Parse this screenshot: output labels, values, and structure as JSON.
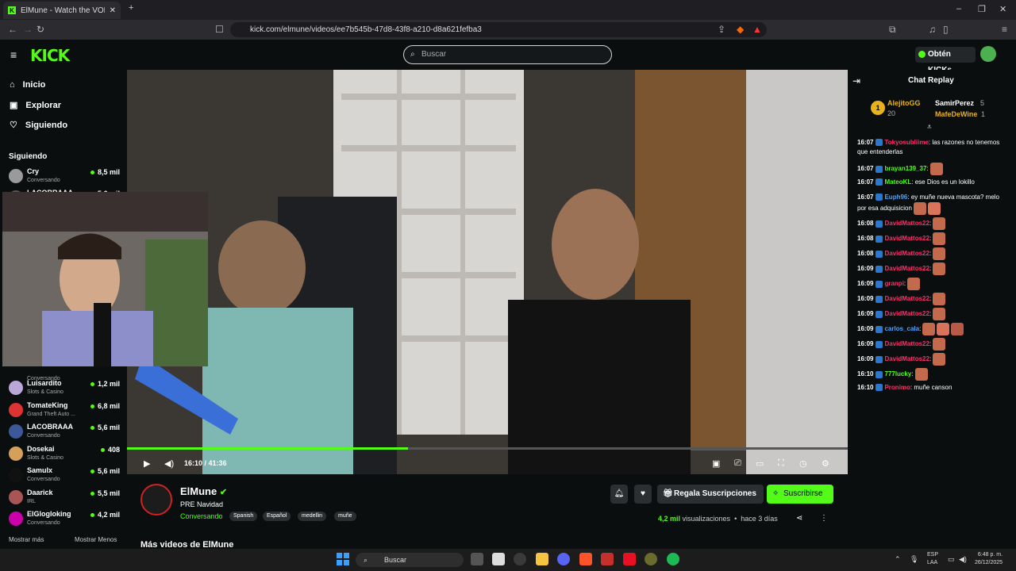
{
  "browser": {
    "tab_title": "ElMune - Watch the VOD on Kick",
    "new_tab": "+",
    "url": "kick.com/elmune/videos/ee7b545b-47d8-43f8-a210-d8a621fefba3",
    "window_controls": [
      "–",
      "❐",
      "✕"
    ]
  },
  "header": {
    "logo": "KICK",
    "search_placeholder": "Buscar",
    "kicks_button": "Obtén KICKs"
  },
  "sidebar": {
    "nav": [
      {
        "label": "Inicio",
        "icon": "home-icon"
      },
      {
        "label": "Explorar",
        "icon": "explore-icon"
      },
      {
        "label": "Siguiendo",
        "icon": "heart-icon"
      }
    ],
    "following_title": "Siguiendo",
    "channels": [
      {
        "name": "Cry",
        "category": "Conversando",
        "viewers": "8,5 mil",
        "color": "#9a9a9a"
      },
      {
        "name": "LACOBRAAA",
        "category": "",
        "viewers": "5,6 mil",
        "color": "#555"
      },
      {
        "name": "",
        "category": "Conversando",
        "viewers": "",
        "color": "#555"
      },
      {
        "name": "Luisardito",
        "category": "Slots & Casino",
        "viewers": "1,2 mil",
        "color": "#b9a7d8"
      },
      {
        "name": "TomateKing",
        "category": "Grand Theft Auto ...",
        "viewers": "6,8 mil",
        "color": "#d33"
      },
      {
        "name": "LACOBRAAA",
        "category": "Conversando",
        "viewers": "5,6 mil",
        "color": "#3b5998"
      },
      {
        "name": "Dosekai",
        "category": "Slots & Casino",
        "viewers": "408",
        "color": "#d4a05a"
      },
      {
        "name": "Samulx",
        "category": "Conversando",
        "viewers": "5,6 mil",
        "color": "#111"
      },
      {
        "name": "Daarick",
        "category": "IRL",
        "viewers": "5,5 mil",
        "color": "#a55"
      },
      {
        "name": "ElGlogloking",
        "category": "Conversando",
        "viewers": "4,2 mil",
        "color": "#c0a"
      }
    ],
    "show_more": "Mostrar más",
    "show_less": "Mostrar Menos"
  },
  "player": {
    "time": "16:10 / 41:36",
    "progress": 0.39
  },
  "stream": {
    "name": "ElMune",
    "title": "PRE Navidad",
    "category": "Conversando",
    "tags": [
      "Spanish",
      "Español",
      "medellin",
      "muñe"
    ],
    "gift_button": "Regala Suscripciones",
    "subscribe_button": "Suscribirse",
    "views_count": "4,2 mil",
    "views_label": "visualizaciones",
    "ago": "hace 3 días",
    "more_videos": "Más videos de ElMune"
  },
  "chat": {
    "title": "Chat Replay",
    "pinned": [
      {
        "name": "AlejitoGG",
        "count": "20"
      },
      {
        "name": "SamirPerez",
        "count": "5"
      },
      {
        "name": "MafeDeWine",
        "count": "1"
      }
    ],
    "messages": [
      {
        "time": "16:07",
        "user": "Tokyosubliime",
        "color": "#ff2e6a",
        "text": ": las razones no tenemos que entenderlas",
        "emotes": 0
      },
      {
        "time": "16:07",
        "user": "brayan139_37",
        "color": "#53fc18",
        "text": ":",
        "emotes": 1
      },
      {
        "time": "16:07",
        "user": "MateoKL",
        "color": "#53fc18",
        "text": ": ese Dios es un lokillo",
        "emotes": 0
      },
      {
        "time": "16:07",
        "user": "Euph96",
        "color": "#4aa3ff",
        "text": ": ey muñe nueva mascota? melo por esa adquisicion",
        "emotes": 2
      },
      {
        "time": "16:08",
        "user": "DavidMattos22",
        "color": "#ff2e6a",
        "text": ":",
        "emotes": 1
      },
      {
        "time": "16:08",
        "user": "DavidMattos22",
        "color": "#ff2e6a",
        "text": ":",
        "emotes": 1
      },
      {
        "time": "16:08",
        "user": "DavidMattos22",
        "color": "#ff2e6a",
        "text": ":",
        "emotes": 1
      },
      {
        "time": "16:09",
        "user": "DavidMattos22",
        "color": "#ff2e6a",
        "text": ":",
        "emotes": 1
      },
      {
        "time": "16:09",
        "user": "granpi",
        "color": "#ff2e6a",
        "text": ":",
        "emotes": 1
      },
      {
        "time": "16:09",
        "user": "DavidMattos22",
        "color": "#ff2e6a",
        "text": ":",
        "emotes": 1
      },
      {
        "time": "16:09",
        "user": "DavidMattos22",
        "color": "#ff2e6a",
        "text": ":",
        "emotes": 1
      },
      {
        "time": "16:09",
        "user": "carlos_cala",
        "color": "#4aa3ff",
        "text": ":",
        "emotes": 3
      },
      {
        "time": "16:09",
        "user": "DavidMattos22",
        "color": "#ff2e6a",
        "text": ":",
        "emotes": 1
      },
      {
        "time": "16:09",
        "user": "DavidMattos22",
        "color": "#ff2e6a",
        "text": ":",
        "emotes": 1
      },
      {
        "time": "16:10",
        "user": "777lucky",
        "color": "#53fc18",
        "text": ":",
        "emotes": 1
      },
      {
        "time": "16:10",
        "user": "Pronimo",
        "color": "#ff2e6a",
        "text": ": muñe canson",
        "emotes": 0
      }
    ]
  },
  "taskbar": {
    "search": "Buscar",
    "lang": "ESP",
    "region": "LAA",
    "time": "6:48 p. m.",
    "date": "26/12/2025"
  },
  "colors": {
    "accent": "#53fc18",
    "bg": "#0b0e0f"
  }
}
